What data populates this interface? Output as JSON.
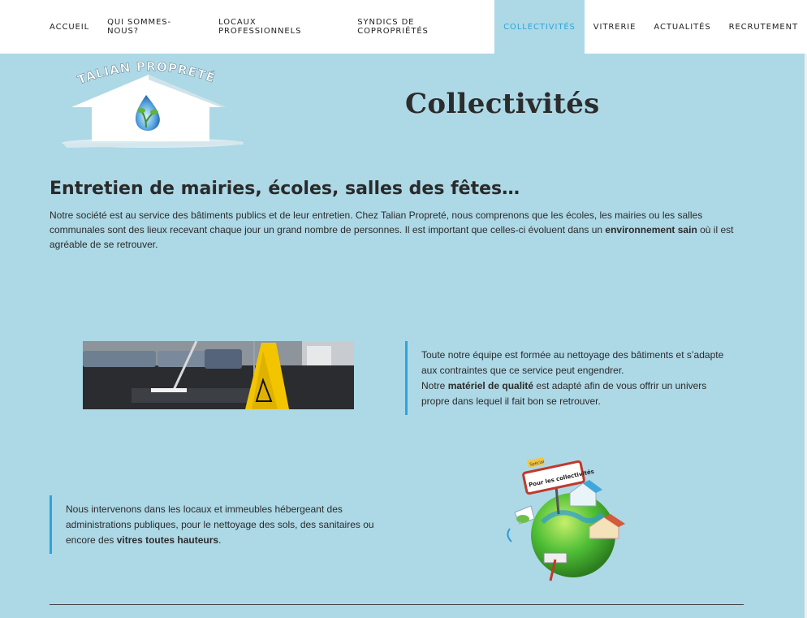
{
  "nav": {
    "items": [
      {
        "label": "ACCUEIL"
      },
      {
        "label": "QUI SOMMES-NOUS?"
      },
      {
        "label": "LOCAUX PROFESSIONNELS"
      },
      {
        "label": "SYNDICS DE COPROPRIÉTÉS"
      },
      {
        "label": "COLLECTIVITÉS"
      },
      {
        "label": "VITRERIE"
      },
      {
        "label": "ACTUALITÉS"
      },
      {
        "label": "RECRUTEMENT"
      }
    ],
    "active_index": 4
  },
  "logo": {
    "text": "TALIAN PROPRETÉ"
  },
  "page_title": "Collectivités",
  "section_heading": "Entretien de mairies, écoles, salles des fêtes…",
  "intro": {
    "text_before": "Notre société est au service des bâtiments publics et de leur entretien. Chez Talian Propreté, nous comprenons que les écoles, les mairies ou les salles communales sont des lieux recevant chaque jour un grand nombre de personnes. Il est important que celles-ci évoluent dans un ",
    "bold": "environnement sain",
    "text_after": " où il est agréable de se retrouver."
  },
  "quote1": {
    "line1": "Toute notre équipe est formée au nettoyage des bâtiments et s’adapte aux contraintes que ce service peut engendrer.",
    "line2_before": "Notre ",
    "line2_bold": "matériel de qualité",
    "line2_after": " est adapté afin de vous offrir un univers propre dans lequel il fait bon se retrouver."
  },
  "quote2": {
    "text_before": "Nous intervenons dans les locaux et immeubles hébergeant des administrations publiques, pour le nettoyage des sols, des sanitaires ou encore des ",
    "bold": "vitres toutes hauteurs",
    "text_after": "."
  },
  "globe": {
    "sign_small": "Spécial",
    "sign_text": "Pour les collectivités"
  },
  "colors": {
    "accent": "#2ea5d8",
    "background": "#add8e6",
    "nav_bg": "#ffffff"
  }
}
